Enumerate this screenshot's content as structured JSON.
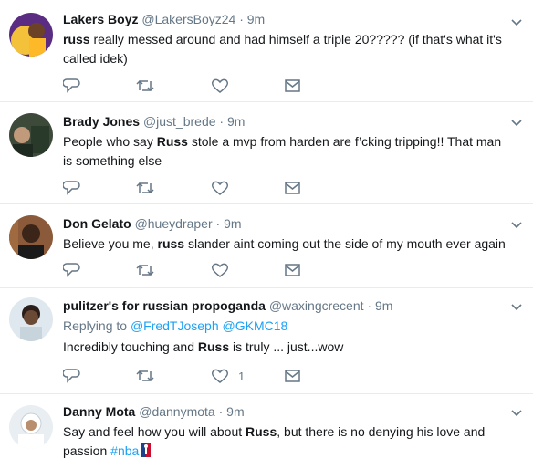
{
  "tweets": [
    {
      "name": "Lakers Boyz",
      "handle": "@LakersBoyz24",
      "time": "9m",
      "text_bold": "russ",
      "text_rest": " really messed around and had himself a triple 20????? (if that's what it's called idek)",
      "like_count": ""
    },
    {
      "name": "Brady Jones",
      "handle": "@just_brede",
      "time": "9m",
      "text_pre": "People who say ",
      "text_bold": "Russ",
      "text_rest": " stole a mvp from harden are f’cking tripping!! That man is something else",
      "like_count": ""
    },
    {
      "name": "Don Gelato",
      "handle": "@hueydraper",
      "time": "9m",
      "text_pre": "Believe you me, ",
      "text_bold": "russ",
      "text_rest": " slander aint coming out the side of my mouth ever again",
      "like_count": ""
    },
    {
      "name": "pulitzer's for russian propoganda",
      "handle": "@waxingcrecent",
      "time": "9m",
      "reply_label": "Replying to",
      "reply_user1": "@FredTJoseph",
      "reply_user2": "@GKMC18",
      "text_pre": "Incredibly touching and ",
      "text_bold": "Russ",
      "text_rest": " is truly ... just...wow",
      "like_count": "1"
    },
    {
      "name": "Danny Mota",
      "handle": "@dannymota",
      "time": "9m",
      "text_pre": "Say and feel how you will about ",
      "text_bold": "Russ",
      "text_rest": ", but there is no denying his love  and passion ",
      "hashtag": "#nba",
      "like_count": ""
    }
  ],
  "separator": "·",
  "icons": [
    "reply-icon",
    "retweet-icon",
    "like-icon",
    "message-icon",
    "caret-down-icon"
  ],
  "colors": {
    "text": "#14171a",
    "muted": "#657786",
    "link": "#1da1f2",
    "border": "#e6ecf0"
  }
}
